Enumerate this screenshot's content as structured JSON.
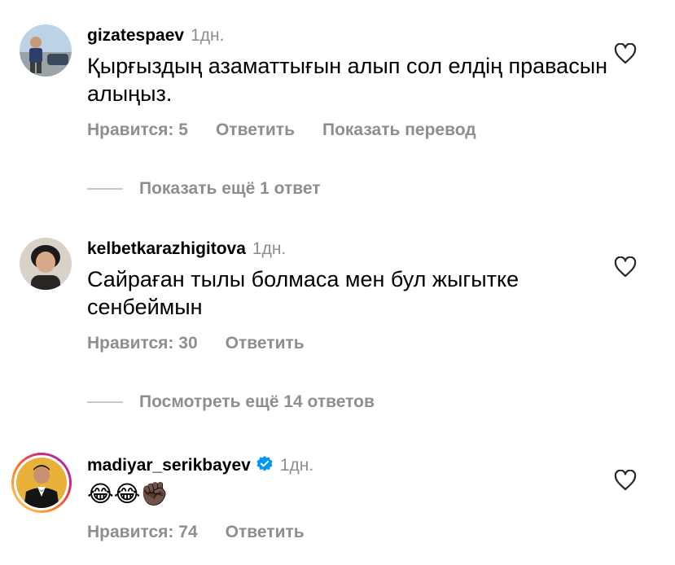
{
  "comments": [
    {
      "username": "gizatespaev",
      "time": "1дн.",
      "text": "Қырғыздың азаматтығын алып сол елдің правасын алыңыз.",
      "likes": "Нравится: 5",
      "reply": "Ответить",
      "translate": "Показать перевод"
    },
    {
      "username": "kelbetkarazhigitova",
      "time": "1дн.",
      "text": "Сайраған тылы болмаса мен бул жыгытке сенбеймын",
      "likes": "Нравится: 30",
      "reply": "Ответить"
    },
    {
      "username": "madiyar_serikbayev",
      "time": "1дн.",
      "text": "😂😂✊🏿",
      "likes": "Нравится: 74",
      "reply": "Ответить",
      "verified": true
    }
  ],
  "threads": [
    {
      "label": "Показать ещё 1 ответ"
    },
    {
      "label": "Посмотреть ещё 14 ответов"
    }
  ],
  "icons": {
    "like": "heart-icon",
    "verified": "verified-badge-icon"
  },
  "colors": {
    "secondary_text": "#8e8e8e",
    "verified_blue": "#0095f6",
    "story_ring": "#d6249f"
  }
}
